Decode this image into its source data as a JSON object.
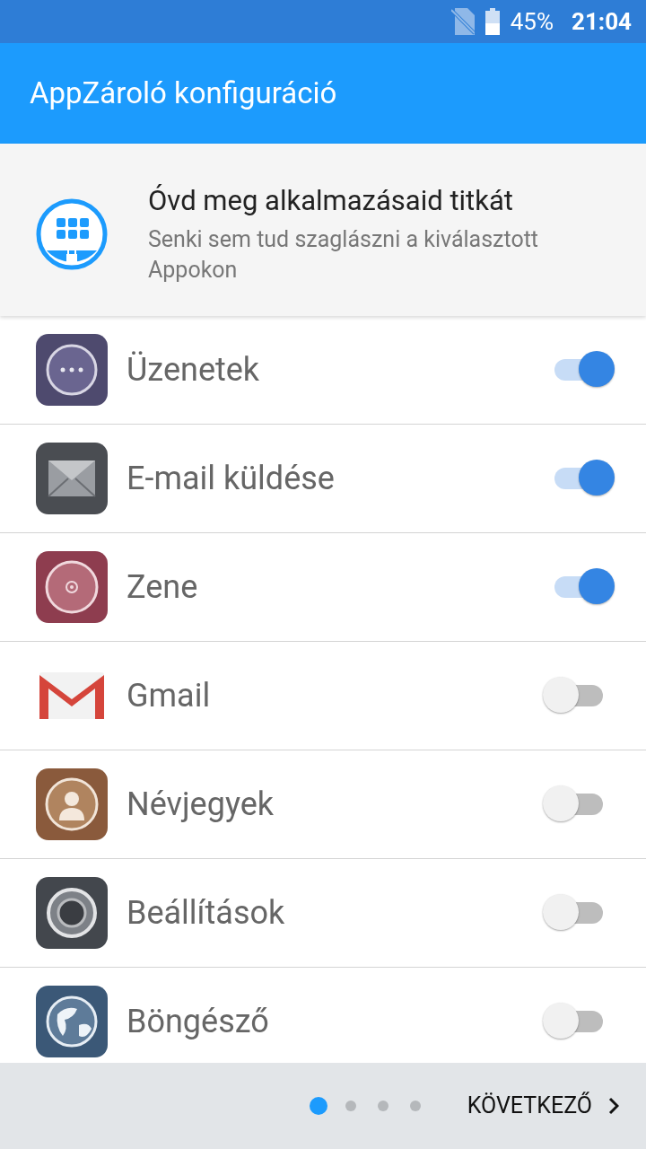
{
  "status_bar": {
    "battery": "45%",
    "time": "21:04"
  },
  "app_bar": {
    "title": "AppZároló konfiguráció"
  },
  "header": {
    "title": "Óvd meg alkalmazásaid titkát",
    "subtitle": "Senki sem tud szaglászni a kiválasztott Appokon"
  },
  "apps": [
    {
      "name": "Üzenetek",
      "kind": "messages",
      "on": true
    },
    {
      "name": "E-mail küldése",
      "kind": "email",
      "on": true
    },
    {
      "name": "Zene",
      "kind": "music",
      "on": true
    },
    {
      "name": "Gmail",
      "kind": "gmail",
      "on": false
    },
    {
      "name": "Névjegyek",
      "kind": "contacts",
      "on": false
    },
    {
      "name": "Beállítások",
      "kind": "settings",
      "on": false
    },
    {
      "name": "Böngésző",
      "kind": "browser",
      "on": false
    }
  ],
  "footer": {
    "pages": [
      {
        "selected": true
      },
      {
        "selected": false
      },
      {
        "selected": false
      },
      {
        "selected": false
      }
    ],
    "next": "KÖVETKEZŐ"
  }
}
